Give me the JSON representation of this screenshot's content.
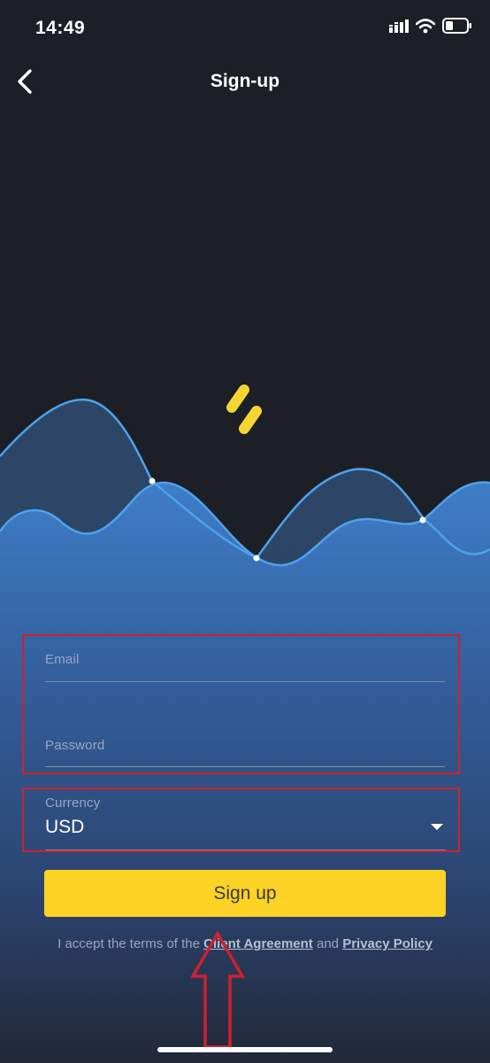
{
  "status_bar": {
    "time": "14:49",
    "icons": [
      "signal-icon",
      "wifi-icon",
      "battery-icon"
    ]
  },
  "nav": {
    "back_icon": "chevron-left-icon",
    "title": "Sign-up"
  },
  "form": {
    "email": {
      "label": "Email",
      "value": ""
    },
    "password": {
      "label": "Password",
      "value": ""
    },
    "currency": {
      "label": "Currency",
      "value": "USD"
    }
  },
  "signup_button": {
    "label": "Sign up"
  },
  "terms": {
    "prefix": "I accept the terms of the ",
    "client_agreement": "Client Agreement",
    "and": " and ",
    "privacy_policy": "Privacy Policy"
  },
  "colors": {
    "background": "#1d1f26",
    "accent_yellow": "#fcd225",
    "wave_blue": "#3f7cc6",
    "wave_line": "#4a9ee6",
    "annotation_red": "#d1202e"
  }
}
